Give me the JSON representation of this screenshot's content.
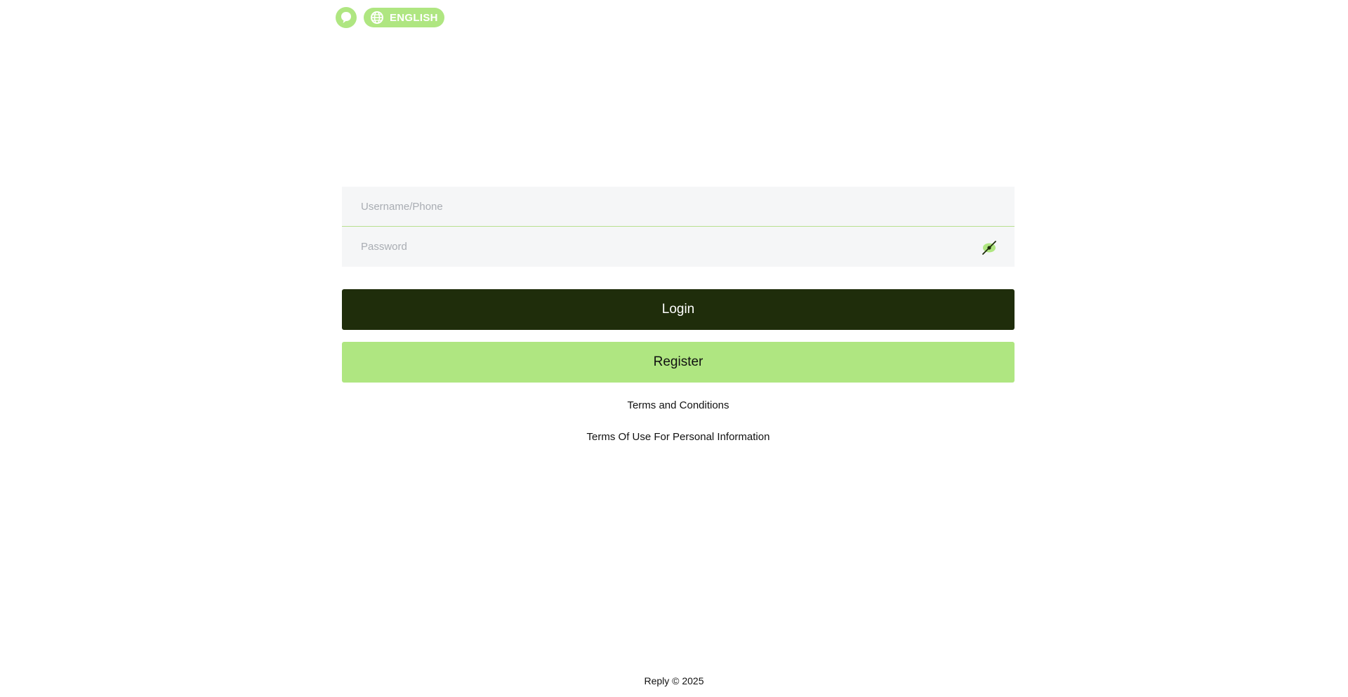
{
  "header": {
    "support_icon": "chat-bubble-icon",
    "language": {
      "icon": "globe-icon",
      "label": "ENGLISH"
    }
  },
  "login_form": {
    "username": {
      "placeholder": "Username/Phone",
      "value": ""
    },
    "password": {
      "placeholder": "Password",
      "value": "",
      "toggle_icon": "eye-off-icon"
    },
    "login_label": "Login",
    "register_label": "Register"
  },
  "links": {
    "terms": "Terms and Conditions",
    "privacy": "Terms Of Use For Personal Information"
  },
  "footer": {
    "copyright": "Reply © 2025"
  },
  "colors": {
    "accent": "#afe681",
    "login_button": "#1f2d0b",
    "field_background": "#f5f6f7"
  }
}
